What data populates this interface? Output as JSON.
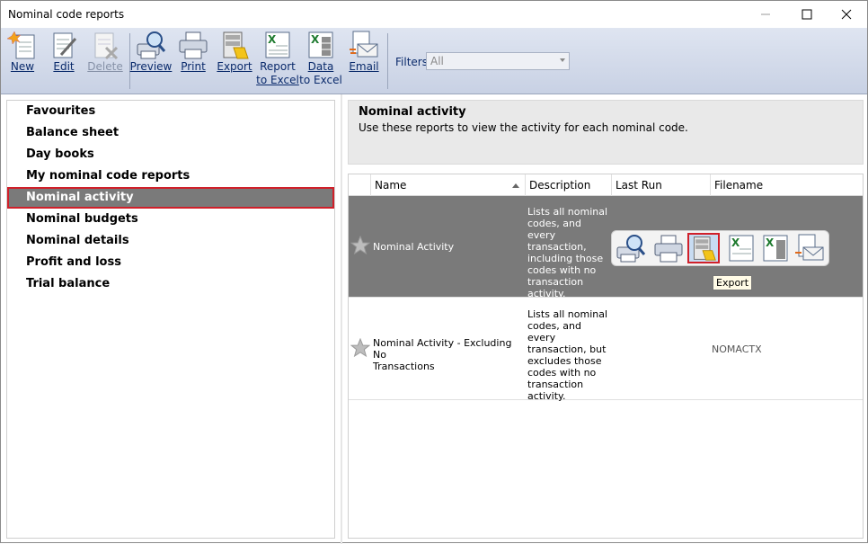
{
  "window": {
    "title": "Nominal code reports"
  },
  "toolbar": {
    "new": "New",
    "edit": "Edit",
    "delete": "Delete",
    "preview": "Preview",
    "print": "Print",
    "export": "Export",
    "report_to_excel_1": "Report",
    "report_to_excel_2": "to Excel",
    "data_to_excel_1": "Data",
    "data_to_excel_2": "to Excel",
    "email": "Email",
    "filters_label": "Filters",
    "filters_value": "All"
  },
  "sidebar": {
    "items": [
      {
        "label": "Favourites"
      },
      {
        "label": "Balance sheet"
      },
      {
        "label": "Day books"
      },
      {
        "label": "My nominal code reports"
      },
      {
        "label": "Nominal activity",
        "selected": true
      },
      {
        "label": "Nominal budgets"
      },
      {
        "label": "Nominal details"
      },
      {
        "label": "Profit and loss"
      },
      {
        "label": "Trial balance"
      }
    ]
  },
  "info": {
    "title": "Nominal activity",
    "description": "Use these reports to view the activity for each nominal code."
  },
  "grid": {
    "headers": {
      "name": "Name",
      "description": "Description",
      "last_run": "Last Run",
      "filename": "Filename"
    },
    "rows": [
      {
        "name": "Nominal Activity",
        "description": [
          "Lists all nominal",
          "codes, and every",
          "transaction,",
          "including those",
          "codes with no",
          "transaction",
          "activity."
        ],
        "filename": ""
      },
      {
        "name": [
          "Nominal Activity - Excluding No",
          "Transactions"
        ],
        "description": [
          "Lists all nominal",
          "codes, and every",
          "transaction, but",
          "excludes those",
          "codes with no",
          "transaction",
          "activity."
        ],
        "filename": "NOMACTX"
      }
    ],
    "tooltip": "Export"
  },
  "colors": {
    "selection": "#7a7a7a",
    "highlight": "#d0202a",
    "toolbar_bg": "#d4dcec"
  },
  "icons": [
    "new-icon",
    "edit-icon",
    "delete-icon",
    "preview-icon",
    "print-icon",
    "export-icon",
    "report-to-excel-icon",
    "data-to-excel-icon",
    "email-icon",
    "star-icon"
  ]
}
